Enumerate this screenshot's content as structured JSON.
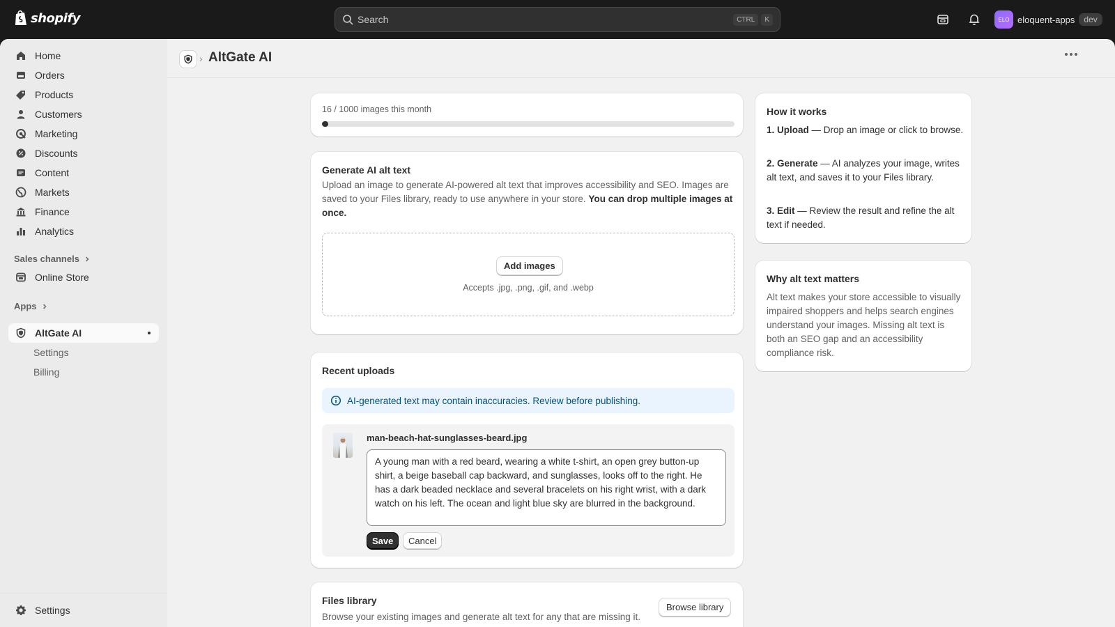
{
  "topbar": {
    "brand": "shopify",
    "search_placeholder": "Search",
    "shortcut": [
      "CTRL",
      "K"
    ],
    "account": {
      "avatar_initials": "ELO",
      "name": "eloquent-apps",
      "badge": "dev"
    }
  },
  "sidebar": {
    "items": [
      {
        "label": "Home",
        "icon": "home-icon"
      },
      {
        "label": "Orders",
        "icon": "orders-icon"
      },
      {
        "label": "Products",
        "icon": "products-icon"
      },
      {
        "label": "Customers",
        "icon": "customers-icon"
      },
      {
        "label": "Marketing",
        "icon": "marketing-icon"
      },
      {
        "label": "Discounts",
        "icon": "discounts-icon"
      },
      {
        "label": "Content",
        "icon": "content-icon"
      },
      {
        "label": "Markets",
        "icon": "markets-icon"
      },
      {
        "label": "Finance",
        "icon": "finance-icon"
      },
      {
        "label": "Analytics",
        "icon": "analytics-icon"
      }
    ],
    "sales_channels": {
      "heading": "Sales channels",
      "items": [
        {
          "label": "Online Store"
        }
      ]
    },
    "apps": {
      "heading": "Apps",
      "app_label": "AltGate AI",
      "sub_items": [
        "Settings",
        "Billing"
      ]
    },
    "settings_label": "Settings"
  },
  "page": {
    "title": "AltGate AI"
  },
  "usage": {
    "label": "16 / 1000 images this month",
    "used": 16,
    "limit": 1000
  },
  "generate": {
    "title": "Generate AI alt text",
    "description": "Upload an image to generate AI-powered alt text that improves accessibility and SEO. Images are saved to your Files library, ready to use anywhere in your store.",
    "description_bold": "You can drop multiple images at once.",
    "add_button": "Add images",
    "accepts": "Accepts .jpg, .png, .gif, and .webp"
  },
  "recent": {
    "title": "Recent uploads",
    "banner": "AI-generated text may contain inaccuracies. Review before publishing.",
    "item": {
      "filename": "man-beach-hat-sunglasses-beard.jpg",
      "alt_text": "A young man with a red beard, wearing a white t-shirt, an open grey button-up shirt, a beige baseball cap backward, and sunglasses, looks off to the right. He has a dark beaded necklace and several bracelets on his right wrist, with a dark watch on his left. The ocean and light blue sky are blurred in the background.",
      "save_label": "Save",
      "cancel_label": "Cancel"
    }
  },
  "files": {
    "title": "Files library",
    "description": "Browse your existing images and generate alt text for any that are missing it.",
    "button": "Browse library"
  },
  "how": {
    "title": "How it works",
    "steps": [
      {
        "bold": "1. Upload",
        "text": " — Drop an image or click to browse."
      },
      {
        "bold": "2. Generate",
        "text": " — AI analyzes your image, writes alt text, and saves it to your Files library."
      },
      {
        "bold": "3. Edit",
        "text": " — Review the result and refine the alt text if needed."
      }
    ]
  },
  "why": {
    "title": "Why alt text matters",
    "body": "Alt text makes your store accessible to visually impaired shoppers and helps search engines understand your images. Missing alt text is both an SEO gap and an accessibility compliance risk."
  }
}
